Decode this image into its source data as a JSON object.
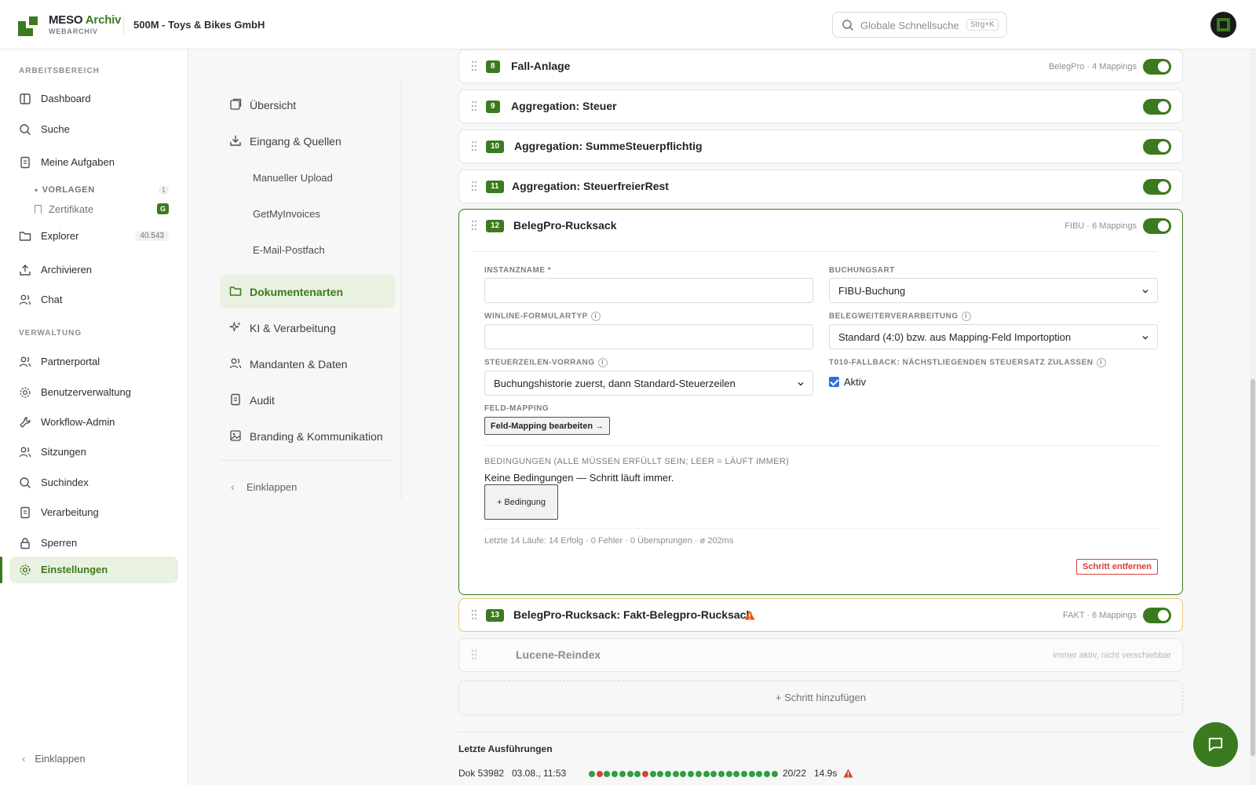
{
  "app": {
    "brand_main": "MESO ",
    "brand_accent": "Archiv",
    "brand_sub": "WEBARCHIV",
    "tenant": "500M - Toys & Bikes GmbH"
  },
  "search": {
    "placeholder": "Globale Schnellsuche",
    "shortcut": "Strg+K"
  },
  "sidebar": {
    "sections": {
      "workspace": "ARBEITSBEREICH",
      "admin": "VERWALTUNG"
    },
    "items": [
      {
        "label": "Dashboard",
        "icon": "columns-icon"
      },
      {
        "label": "Suche",
        "icon": "search-icon"
      },
      {
        "label": "Meine Aufgaben",
        "icon": "document-icon"
      },
      {
        "label": "Explorer",
        "icon": "folder-icon",
        "count": "40.543"
      },
      {
        "label": "Archivieren",
        "icon": "upload-icon"
      },
      {
        "label": "Chat",
        "icon": "users-icon"
      },
      {
        "label": "Partnerportal",
        "icon": "users-icon"
      },
      {
        "label": "Benutzerverwaltung",
        "icon": "gear-icon"
      },
      {
        "label": "Workflow-Admin",
        "icon": "wrench-icon"
      },
      {
        "label": "Sitzungen",
        "icon": "users-icon"
      },
      {
        "label": "Suchindex",
        "icon": "search-icon"
      },
      {
        "label": "Verarbeitung",
        "icon": "document-icon"
      },
      {
        "label": "Sperren",
        "icon": "lock-icon"
      },
      {
        "label": "Einstellungen",
        "icon": "gear-icon",
        "active": true
      }
    ],
    "templates": {
      "label": "VORLAGEN",
      "count": "1",
      "item": "Zertifikate",
      "badge": "G"
    },
    "collapse": "Einklappen"
  },
  "subnav": {
    "items": [
      {
        "label": "Übersicht"
      },
      {
        "label": "Eingang & Quellen"
      },
      {
        "label": "Manueller Upload"
      },
      {
        "label": "GetMyInvoices"
      },
      {
        "label": "E-Mail-Postfach"
      },
      {
        "label": "Dokumentenarten",
        "active": true
      },
      {
        "label": "KI & Verarbeitung"
      },
      {
        "label": "Mandanten & Daten"
      },
      {
        "label": "Audit"
      },
      {
        "label": "Branding & Kommunikation"
      }
    ],
    "collapse": "Einklappen"
  },
  "steps": [
    {
      "num": "8",
      "title": "Fall-Anlage",
      "meta": "BelegPro · 4 Mappings",
      "enabled": true
    },
    {
      "num": "9",
      "title": "Aggregation: Steuer",
      "meta": "",
      "enabled": true
    },
    {
      "num": "10",
      "title": "Aggregation: SummeSteuerpflichtig",
      "meta": "",
      "enabled": true
    },
    {
      "num": "11",
      "title": "Aggregation: SteuerfreierRest",
      "meta": "",
      "enabled": true
    },
    {
      "num": "12",
      "title": "BelegPro-Rucksack",
      "meta": "FIBU · 6 Mappings",
      "enabled": true
    },
    {
      "num": "13",
      "title": "BelegPro-Rucksack: Fakt-Belegpro-Rucksack",
      "meta": "FAKT · 6 Mappings",
      "enabled": true,
      "warning": true
    },
    {
      "num": "",
      "title": "Lucene-Reindex",
      "meta": "immer aktiv, nicht verschiebbar"
    }
  ],
  "expanded": {
    "instanzname_label": "INSTANZNAME *",
    "instanzname_value": "",
    "buchungsart_label": "BUCHUNGSART",
    "buchungsart_value": "FIBU-Buchung",
    "winline_label": "WINLINE-FORMULARTYP",
    "winline_value": "",
    "belegweiter_label": "BELEGWEITERVERARBEITUNG",
    "belegweiter_value": "Standard (4:0) bzw. aus Mapping-Feld Importoption",
    "steuerzeilen_label": "STEUERZEILEN-VORRANG",
    "steuerzeilen_value": "Buchungshistorie zuerst, dann Standard-Steuerzeilen",
    "fallback_label": "T010-FALLBACK: NÄCHSTLIEGENDEN STEUERSATZ ZULASSEN",
    "fallback_checked": true,
    "fallback_check_label": "Aktiv",
    "mapping_label": "FELD-MAPPING",
    "mapping_button": "Feld-Mapping bearbeiten →",
    "conditions_label": "BEDINGUNGEN (ALLE MÜSSEN ERFÜLLT SEIN; LEER = LÄUFT IMMER)",
    "conditions_text": "Keine Bedingungen — Schritt läuft immer.",
    "add_condition": "+ Bedingung",
    "stats": "Letzte 14 Läufe: 14 Erfolg · 0 Fehler · 0 Übersprungen · ø 202ms",
    "remove": "Schritt entfernen"
  },
  "add_step": "+ Schritt hinzufügen",
  "runs": {
    "title": "Letzte Ausführungen",
    "doc": "Dok 53982",
    "time": "03.08., 11:53",
    "dots": [
      "ok",
      "err",
      "ok",
      "ok",
      "ok",
      "ok",
      "ok",
      "err",
      "ok",
      "ok",
      "ok",
      "ok",
      "ok",
      "ok",
      "ok",
      "ok",
      "ok",
      "ok",
      "ok",
      "ok",
      "ok",
      "ok",
      "ok",
      "ok",
      "ok"
    ],
    "ratio": "20/22",
    "duration": "14.9s"
  },
  "colors": {
    "brand": "#3b7a1e",
    "ok": "#2f9e44",
    "err": "#d8403a",
    "warn": "#e8590c"
  }
}
